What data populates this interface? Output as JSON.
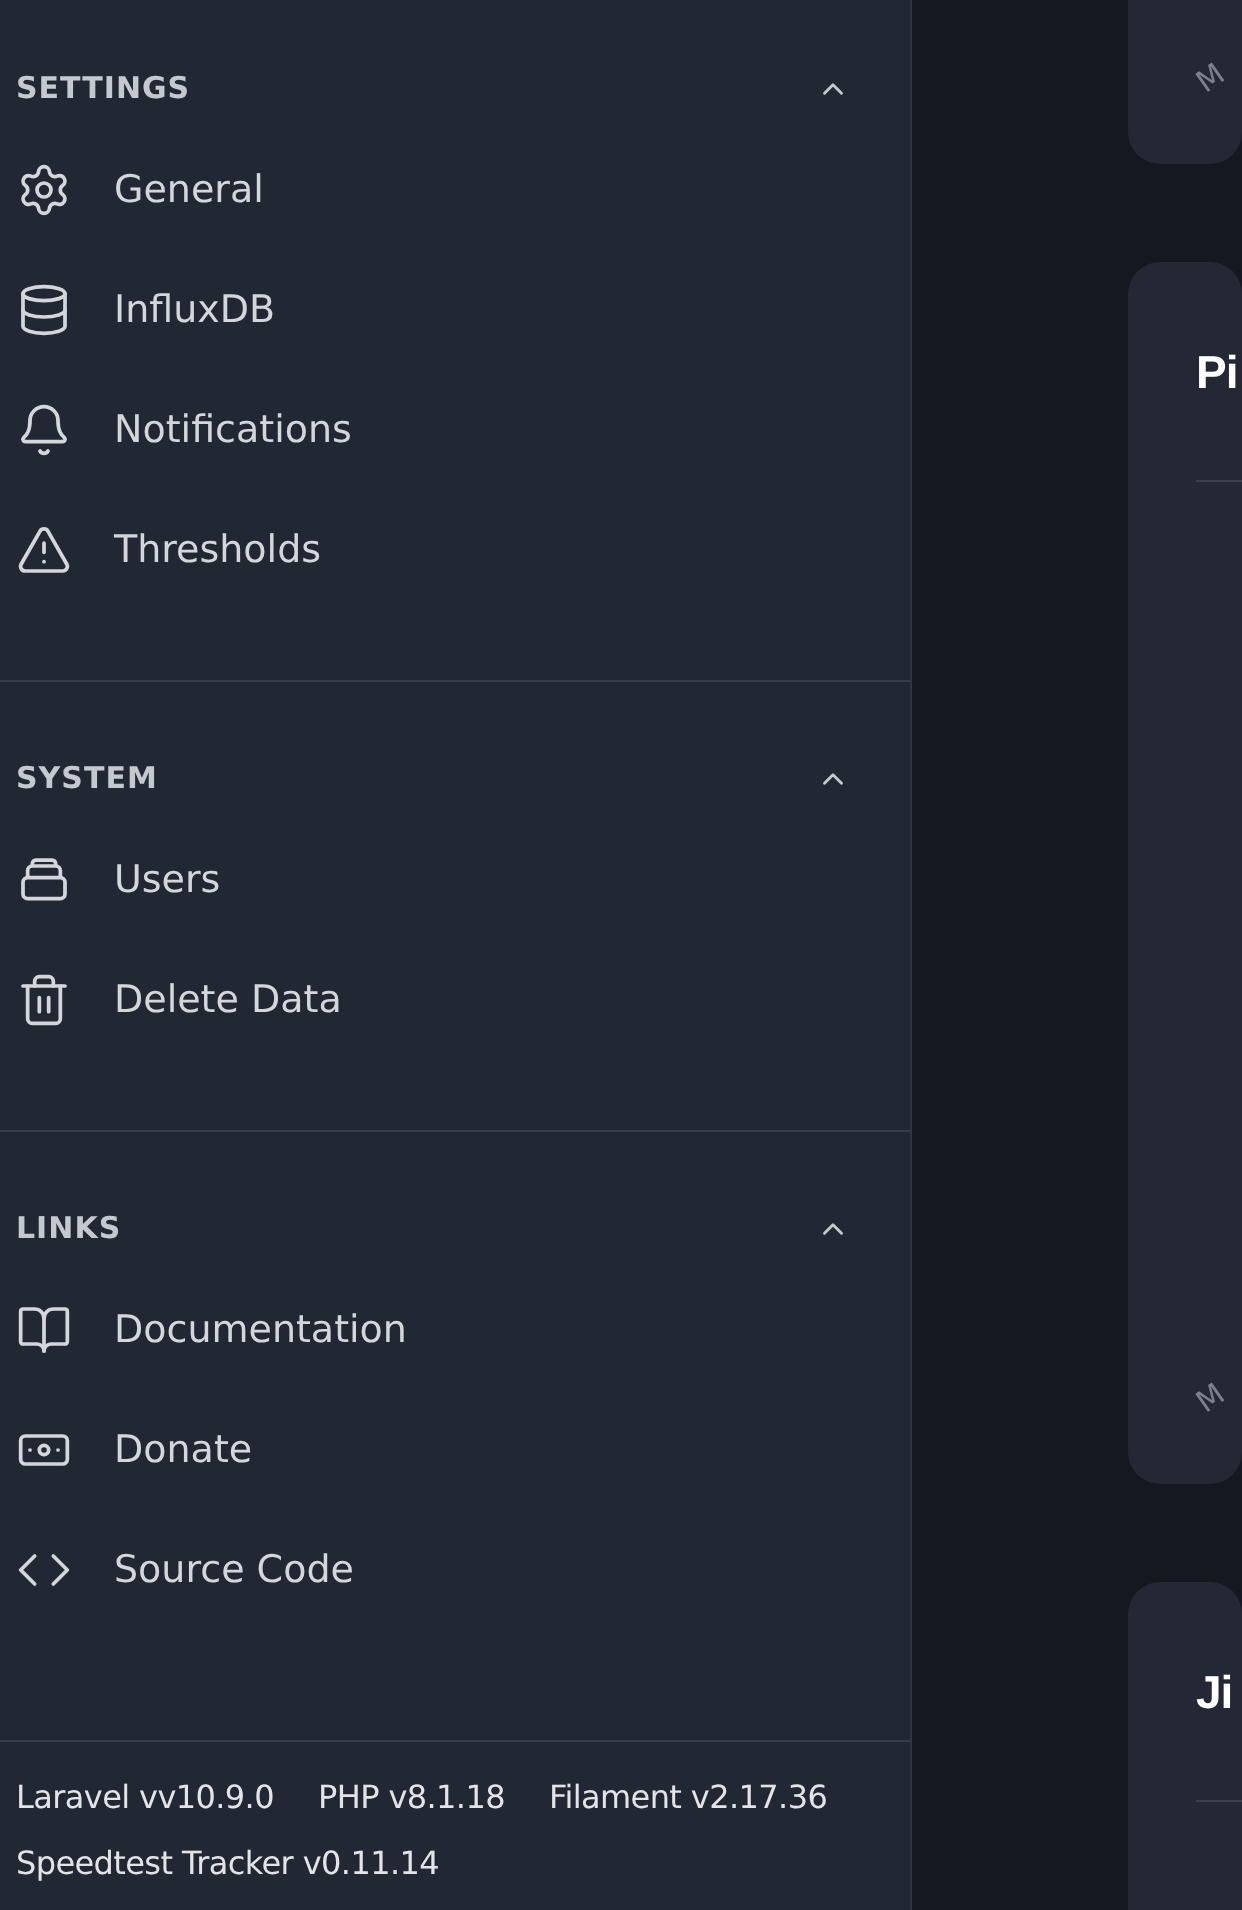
{
  "sidebar": {
    "groups": [
      {
        "label": "SETTINGS",
        "expanded": true,
        "items": [
          {
            "label": "General"
          },
          {
            "label": "InfluxDB"
          },
          {
            "label": "Notifications"
          },
          {
            "label": "Thresholds"
          }
        ]
      },
      {
        "label": "SYSTEM",
        "expanded": true,
        "items": [
          {
            "label": "Users"
          },
          {
            "label": "Delete Data"
          }
        ]
      },
      {
        "label": "LINKS",
        "expanded": true,
        "items": [
          {
            "label": "Documentation"
          },
          {
            "label": "Donate"
          },
          {
            "label": "Source Code"
          }
        ]
      }
    ],
    "footer": {
      "versions": [
        "Laravel vv10.9.0",
        "PHP v8.1.18",
        "Filament v2.17.36"
      ],
      "app_version": "Speedtest Tracker v0.11.14"
    }
  },
  "main": {
    "cards": [
      {
        "axis_label": "M"
      },
      {
        "title": "Pi",
        "axis_label": "M"
      },
      {
        "title": "Ji"
      }
    ]
  }
}
